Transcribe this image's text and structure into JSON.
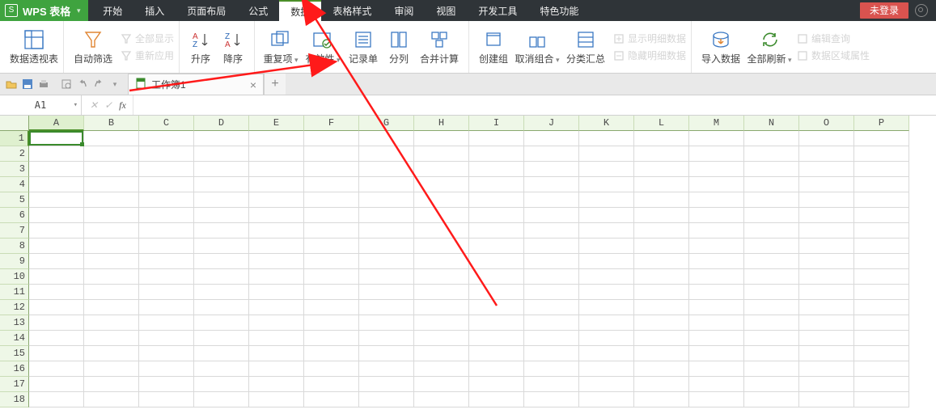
{
  "app": {
    "name": "WPS 表格",
    "login_label": "未登录"
  },
  "menu": [
    "开始",
    "插入",
    "页面布局",
    "公式",
    "数据",
    "表格样式",
    "审阅",
    "视图",
    "开发工具",
    "特色功能"
  ],
  "menu_active": 4,
  "ribbon": {
    "pivot": "数据透视表",
    "autofilter": "自动筛选",
    "show_all": "全部显示",
    "reapply": "重新应用",
    "sort_asc": "升序",
    "sort_desc": "降序",
    "duplicates": "重复项",
    "validation": "有效性",
    "form": "记录单",
    "text_to_cols": "分列",
    "consolidate": "合并计算",
    "group": "创建组",
    "ungroup": "取消组合",
    "subtotal": "分类汇总",
    "show_detail": "显示明细数据",
    "hide_detail": "隐藏明细数据",
    "import": "导入数据",
    "refresh_all": "全部刷新",
    "edit_query": "编辑查询",
    "range_props": "数据区域属性"
  },
  "doc_tab": {
    "name": "工作簿1"
  },
  "cell_ref": "A1",
  "fx_label": "fx",
  "columns": [
    "A",
    "B",
    "C",
    "D",
    "E",
    "F",
    "G",
    "H",
    "I",
    "J",
    "K",
    "L",
    "M",
    "N",
    "O",
    "P"
  ],
  "rows": [
    1,
    2,
    3,
    4,
    5,
    6,
    7,
    8,
    9,
    10,
    11,
    12,
    13,
    14,
    15,
    16,
    17,
    18
  ]
}
